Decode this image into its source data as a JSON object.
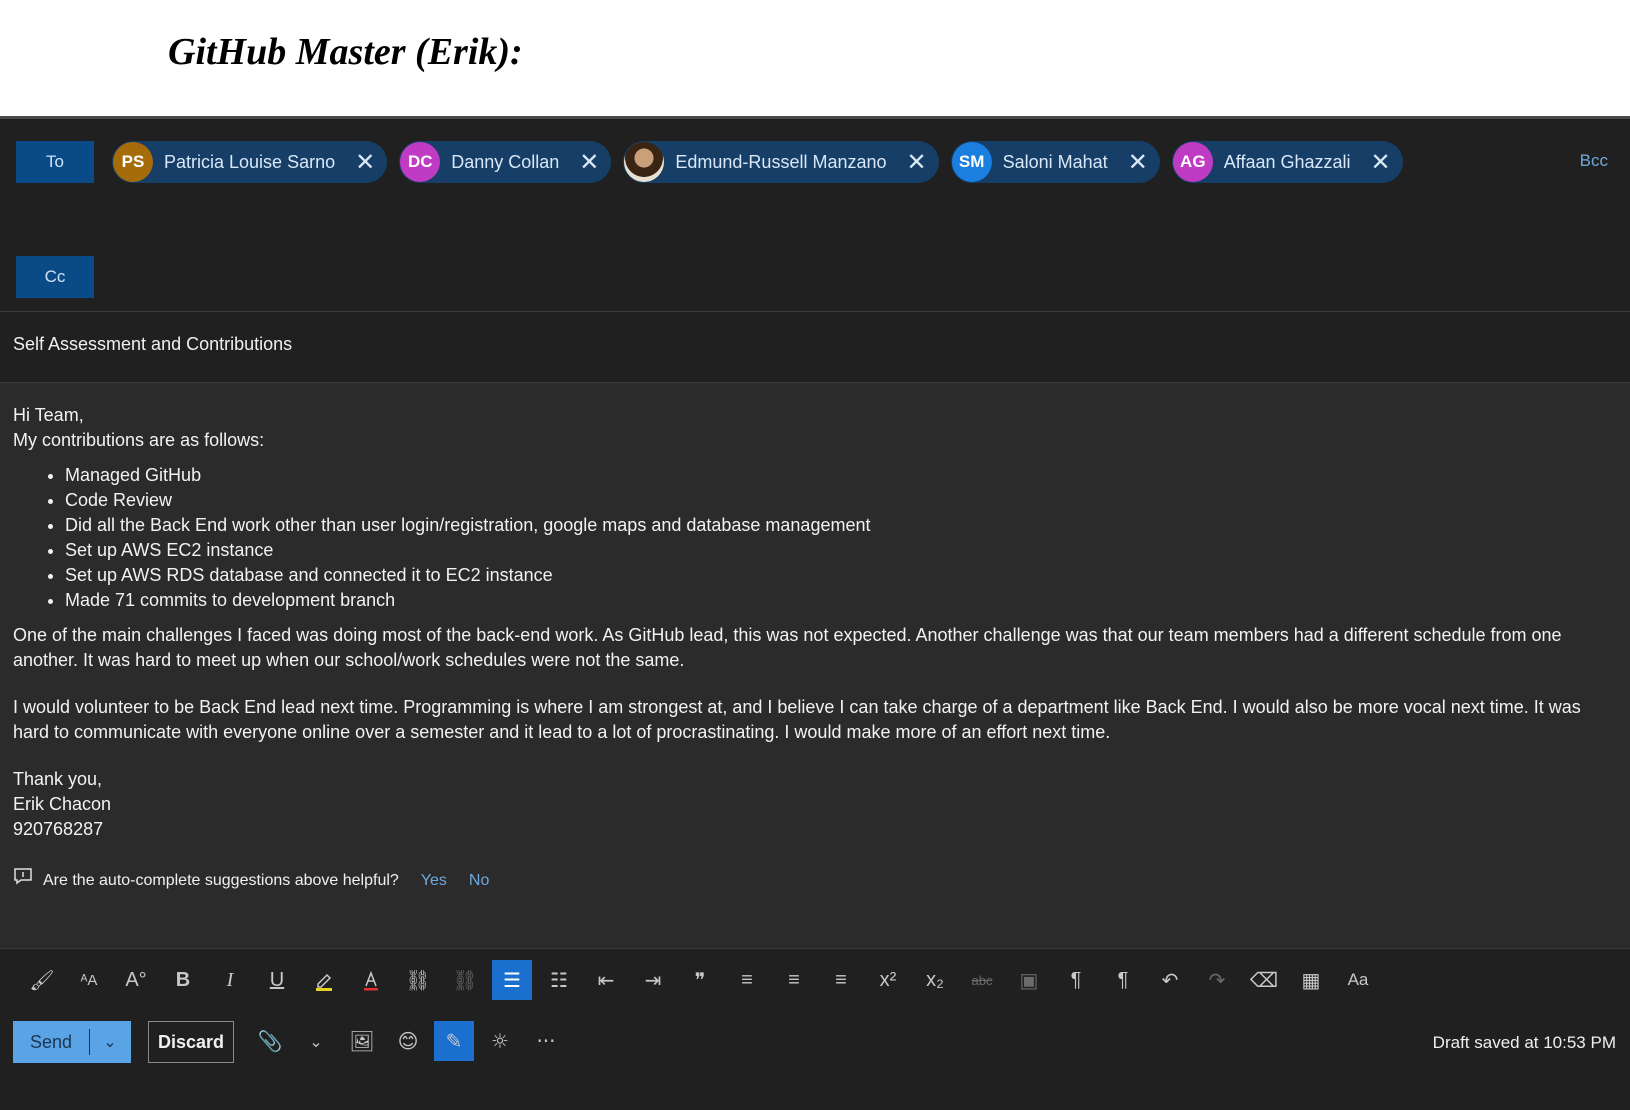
{
  "doc": {
    "title": "GitHub Master (Erik):"
  },
  "compose": {
    "to_label": "To",
    "cc_label": "Cc",
    "bcc_label": "Bcc",
    "recipients": [
      {
        "initials": "PS",
        "name": "Patricia Louise Sarno",
        "color": "#a66c0a"
      },
      {
        "initials": "DC",
        "name": "Danny Collan",
        "color": "#c03bc4"
      },
      {
        "initials": "",
        "name": "Edmund-Russell Manzano",
        "color": "#5a3a22"
      },
      {
        "initials": "SM",
        "name": "Saloni Mahat",
        "color": "#1b7fe0"
      },
      {
        "initials": "AG",
        "name": "Affaan Ghazzali",
        "color": "#c03bc4"
      }
    ],
    "subject": "Self Assessment and Contributions",
    "body": {
      "greeting": "Hi Team,",
      "intro": "My contributions are as follows:",
      "bullets": [
        "Managed GitHub",
        "Code Review",
        "Did all the Back End work other than user login/registration, google maps and database management",
        "Set up AWS EC2 instance",
        "Set up AWS RDS database and connected it to EC2 instance",
        "Made 71 commits to development branch"
      ],
      "paragraph1": "One of the main challenges I faced was doing most of the back-end work. As GitHub lead, this was not expected. Another challenge was that our team members had a different schedule from one another. It was hard to meet up when our school/work schedules were not the same.",
      "paragraph2": "I would volunteer to be Back End lead next time. Programming is where I am strongest at, and I believe I can take charge of a department like Back End. I would also be more vocal next time. It was hard to communicate with everyone online over a semester and it lead to a lot of procrastinating. I would make more of an effort next time.",
      "closing": "Thank you,",
      "signature_name": "Erik Chacon",
      "signature_id": "920768287"
    },
    "feedback": {
      "question": "Are the auto-complete suggestions above helpful?",
      "yes": "Yes",
      "no": "No"
    },
    "toolbar": {
      "font_size_label": "Aa"
    },
    "actions": {
      "send_label": "Send",
      "discard_label": "Discard",
      "more_label": "···",
      "draft_status": "Draft saved at 10:53 PM"
    }
  }
}
